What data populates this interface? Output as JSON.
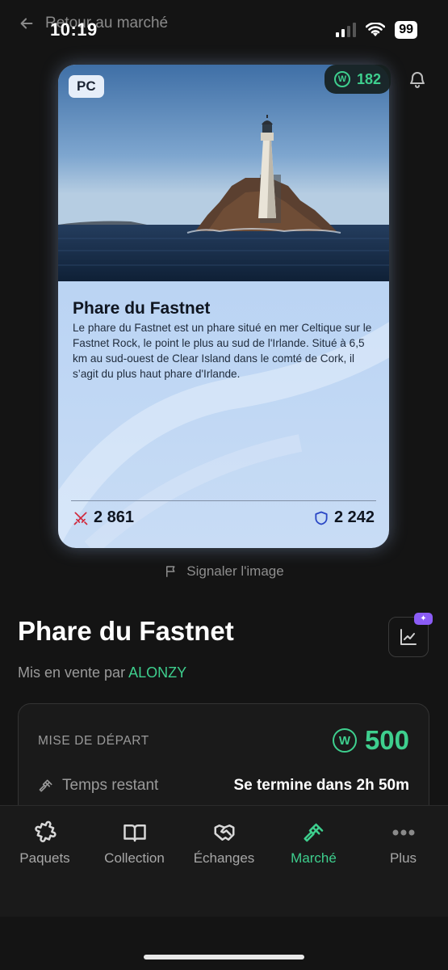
{
  "status_bar": {
    "time": "10:19",
    "battery": "99"
  },
  "header": {
    "back_label": "Retour au marché"
  },
  "card": {
    "badge": "PC",
    "title": "Phare du Fastnet",
    "description": "Le phare du Fastnet est un phare situé en mer Celtique sur le Fastnet Rock, le point le plus au sud de l'Irlande. Situé à 6,5 km au sud-ouest de Clear Island dans le comté de Cork, il s’agit du plus haut phare d'Irlande.",
    "attack": "2 861",
    "defense": "2 242"
  },
  "wallet": {
    "coin_symbol": "W",
    "balance": "182"
  },
  "report_label": "Signaler l'image",
  "listing": {
    "title": "Phare du Fastnet",
    "seller_prefix": "Mis en vente par",
    "seller_name": "ALONZY"
  },
  "auction": {
    "start_label": "MISE DE DÉPART",
    "start_price": "500",
    "time_label": "Temps restant",
    "time_value": "Se termine dans 2h 50m"
  },
  "nav": {
    "items": [
      {
        "label": "Paquets",
        "icon": "puzzle-icon"
      },
      {
        "label": "Collection",
        "icon": "book-icon"
      },
      {
        "label": "Échanges",
        "icon": "handshake-icon"
      },
      {
        "label": "Marché",
        "icon": "gavel-icon",
        "active": true
      },
      {
        "label": "Plus",
        "icon": "more-icon"
      }
    ]
  },
  "colors": {
    "accent": "#3ecf8e",
    "background": "#141414",
    "badge_purple": "#8b5cf6"
  }
}
